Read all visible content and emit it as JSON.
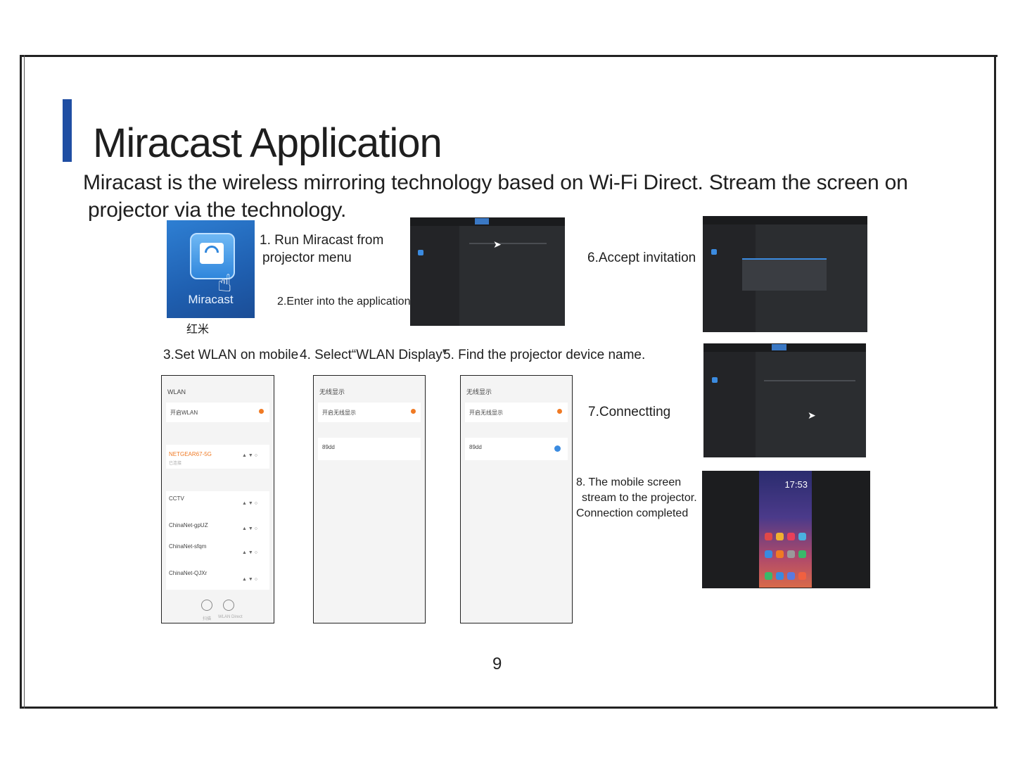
{
  "page": {
    "title": "Miracast Application",
    "intro_line1": "Miracast is the wireless mirroring technology based on Wi-Fi Direct. Stream the screen on",
    "intro_line2": "projector via the technology.",
    "page_number": "9",
    "accent_color": "#1f4ea3"
  },
  "app_icon": {
    "caption": "Miracast",
    "below_label": "红米",
    "icon": "miracast-app-icon"
  },
  "steps": {
    "s1_line1": "1. Run Miracast from",
    "s1_line2": "projector menu",
    "s2": "2.Enter into the application",
    "s3": "3.Set WLAN on mobile",
    "s4": "4. Select“WLAN Display”",
    "s5": "5. Find the projector device name.",
    "s6": "6.Accept invitation",
    "s7": "7.Connectting",
    "s8_line1": "8. The mobile screen",
    "s8_line2": "stream to the projector.",
    "s8_line3": "Connection completed"
  },
  "phone_wlan": {
    "header": "WLAN",
    "toggle_label": "开启WLAN",
    "current_network": "NETGEAR67-5G",
    "current_status": "已连接",
    "networks": [
      "CCTV",
      "ChinaNet-gpUZ",
      "ChinaNet-sfqm",
      "ChinaNet-QJXr"
    ],
    "bottom_buttons": [
      "扫描",
      "WLAN Direct"
    ]
  },
  "phone_display_a": {
    "header": "无线显示",
    "toggle_label": "开启无线显示",
    "device": "89dd"
  },
  "phone_display_b": {
    "header": "无线显示",
    "toggle_label": "开启无线显示",
    "device": "89dd"
  },
  "home_screen": {
    "time": "17:53"
  }
}
